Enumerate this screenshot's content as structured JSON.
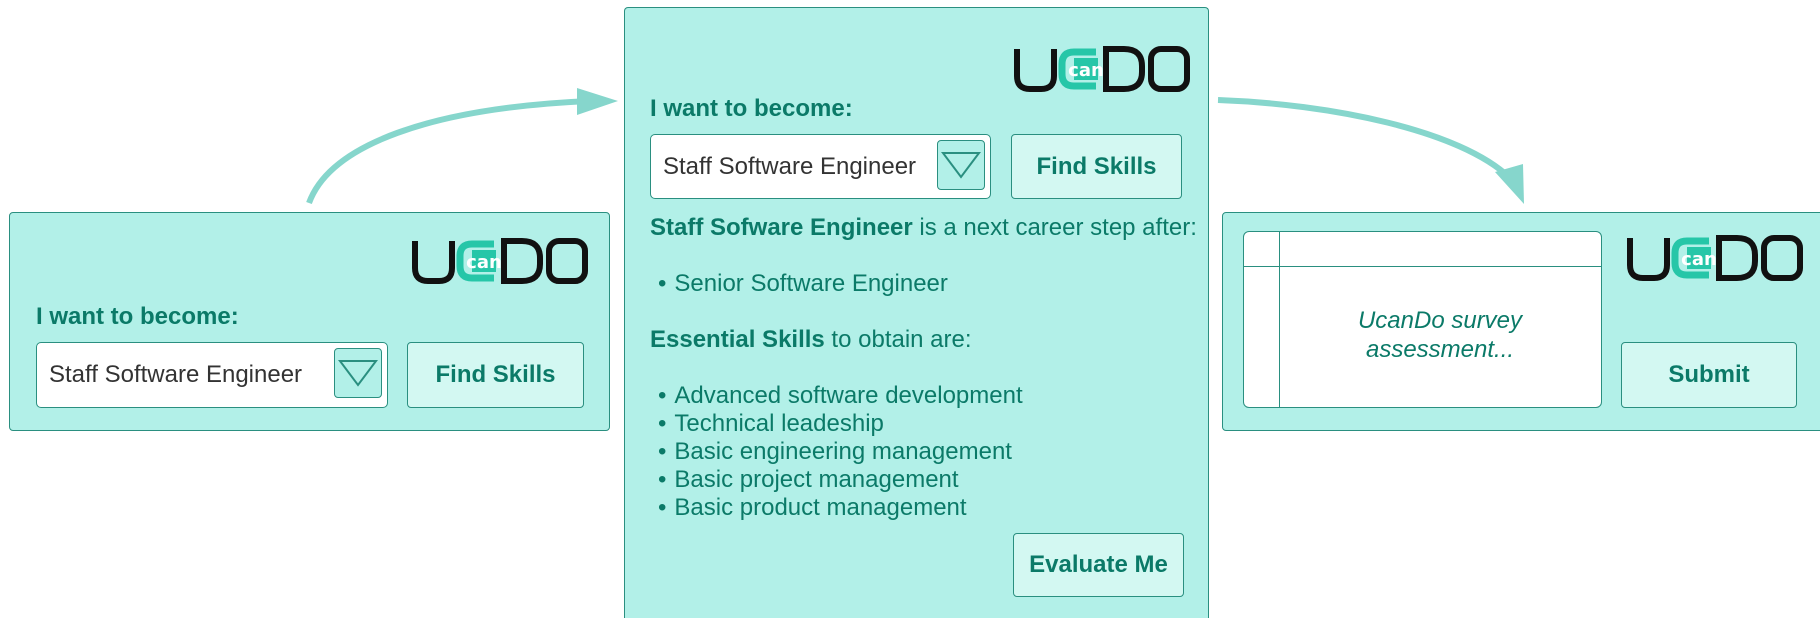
{
  "logo": {
    "parts": [
      "U",
      "can",
      "DO"
    ]
  },
  "colors": {
    "panel_bg": "#b2f0e8",
    "accent": "#0b7a68",
    "border": "#2a8f80",
    "logo_accent": "#26c6a8",
    "arrow": "#86d6cc"
  },
  "panel_left": {
    "label": "I want to become:",
    "select_value": "Staff Software Engineer",
    "button": "Find Skills"
  },
  "panel_middle": {
    "label": "I want to become:",
    "select_value": "Staff Software Engineer",
    "button": "Find Skills",
    "next_step_title": "Staff Sofware Engineer",
    "next_step_suffix": " is a next career step after:",
    "previous_roles": [
      "Senior Software Engineer"
    ],
    "skills_title": "Essential Skills",
    "skills_suffix": " to obtain are:",
    "skills": [
      "Advanced software development",
      "Technical leadeship",
      "Basic engineering management",
      "Basic project management",
      "Basic product management"
    ],
    "evaluate_button": "Evaluate Me"
  },
  "panel_right": {
    "survey_text_line1": "UcanDo survey",
    "survey_text_line2": "assessment...",
    "submit_button": "Submit"
  }
}
